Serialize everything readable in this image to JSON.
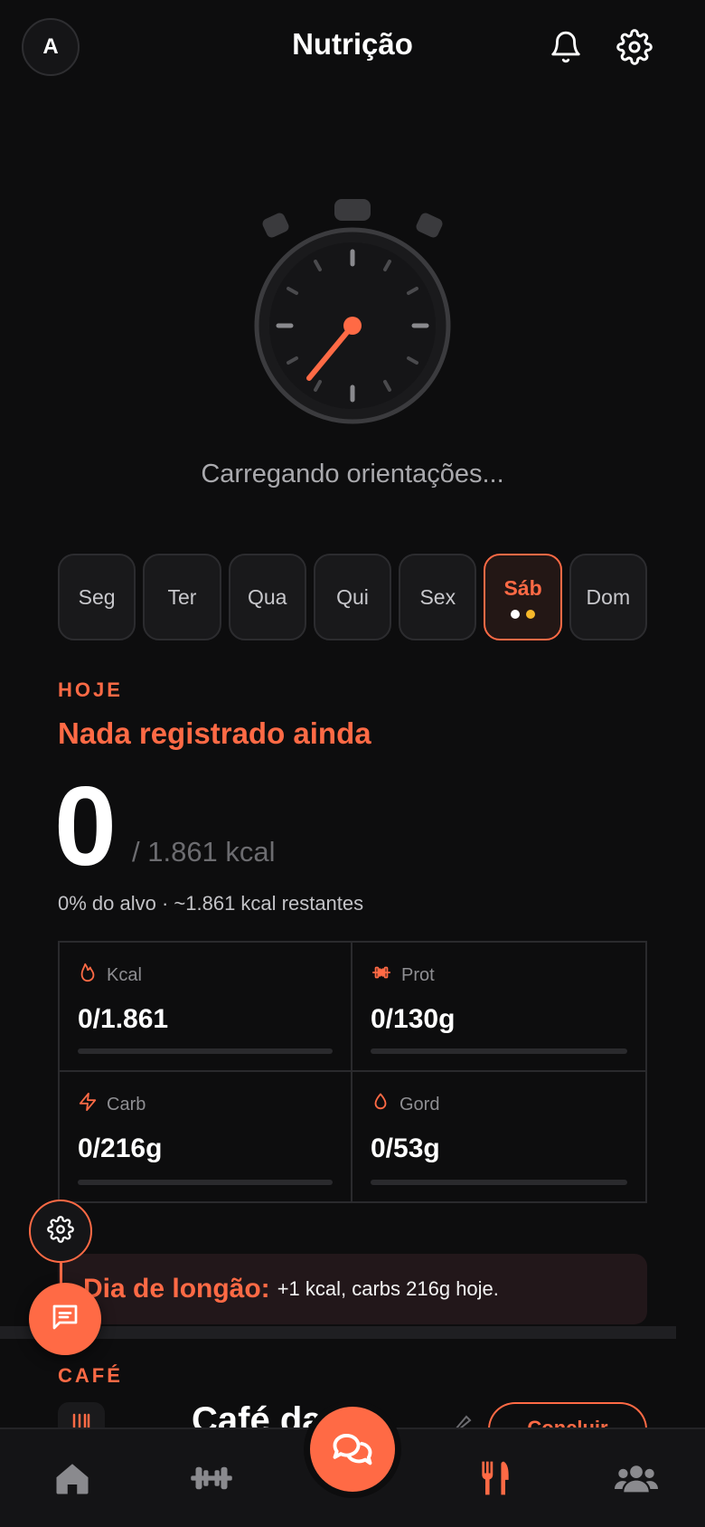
{
  "header": {
    "avatar_initial": "A",
    "title": "Nutrição",
    "icons": [
      "bell-icon",
      "gear-icon"
    ]
  },
  "loading": {
    "text": "Carregando orientações..."
  },
  "days": [
    {
      "label": "Seg",
      "active": false
    },
    {
      "label": "Ter",
      "active": false
    },
    {
      "label": "Qua",
      "active": false
    },
    {
      "label": "Qui",
      "active": false
    },
    {
      "label": "Sex",
      "active": false
    },
    {
      "label": "Sáb",
      "active": true
    },
    {
      "label": "Dom",
      "active": false
    }
  ],
  "today": {
    "section_label": "HOJE",
    "status": "Nada registrado ainda",
    "kcal_consumed": "0",
    "kcal_goal": "/ 1.861 kcal",
    "summary": "0% do alvo · ~1.861 kcal restantes"
  },
  "macros": [
    {
      "label": "Kcal",
      "value": "0/1.861",
      "progress": 0,
      "icon": "flame-icon"
    },
    {
      "label": "Prot",
      "value": "0/130g",
      "progress": 0,
      "icon": "dumbbell-icon"
    },
    {
      "label": "Carb",
      "value": "0/216g",
      "progress": 0,
      "icon": "lightning-icon"
    },
    {
      "label": "Gord",
      "value": "0/53g",
      "progress": 0,
      "icon": "drop-icon"
    }
  ],
  "banner": {
    "title": "Dia de longão:",
    "text": "+1 kcal, carbs 216g hoje."
  },
  "meal_section": {
    "label": "CAFÉ",
    "title": "Café da",
    "conclude_label": "Concluir"
  },
  "colors": {
    "accent": "#ff6a45",
    "background": "#0d0d0e",
    "dot_white": "#ffffff",
    "dot_yellow": "#f5b82a"
  },
  "nav": [
    "home-icon",
    "dumbbell-icon",
    "chat-icon",
    "fork-knife-icon",
    "group-icon"
  ]
}
